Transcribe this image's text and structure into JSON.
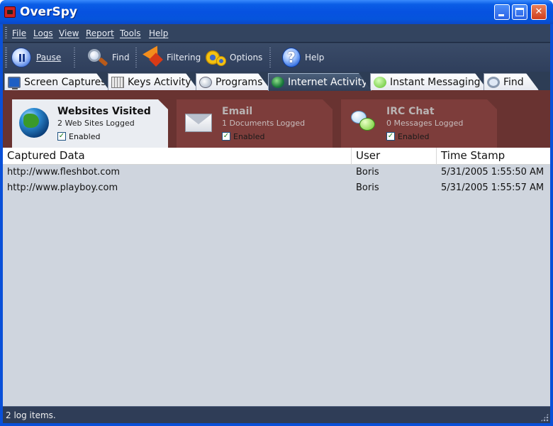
{
  "window": {
    "title": "OverSpy"
  },
  "menu": [
    "File",
    "Logs",
    "View",
    "Report",
    "Tools",
    "Help"
  ],
  "toolbar": {
    "pause": "Pause",
    "find": "Find",
    "filtering": "Filtering",
    "options": "Options",
    "help": "Help"
  },
  "tabs": [
    {
      "label": "Screen Captures",
      "icon": "monitor-icon"
    },
    {
      "label": "Keys Activity",
      "icon": "keyboard-icon"
    },
    {
      "label": "Programs",
      "icon": "programs-icon"
    },
    {
      "label": "Internet Activity",
      "icon": "globe-icon"
    },
    {
      "label": "Instant Messaging",
      "icon": "chat-icon"
    },
    {
      "label": "Find",
      "icon": "magnifier-icon"
    }
  ],
  "active_tab": "Internet Activity",
  "categories": [
    {
      "title": "Websites Visited",
      "subtitle": "2 Web Sites Logged",
      "enabled_label": "Enabled",
      "enabled": true,
      "icon": "globe-icon"
    },
    {
      "title": "Email",
      "subtitle": "1 Documents Logged",
      "enabled_label": "Enabled",
      "enabled": true,
      "icon": "envelope-icon"
    },
    {
      "title": "IRC Chat",
      "subtitle": "0 Messages Logged",
      "enabled_label": "Enabled",
      "enabled": true,
      "icon": "chat-bubbles-icon"
    }
  ],
  "list": {
    "columns": [
      "Captured Data",
      "User",
      "Time Stamp"
    ],
    "rows": [
      {
        "data": "http://www.fleshbot.com",
        "user": "Boris",
        "time": "5/31/2005 1:55:50 AM"
      },
      {
        "data": "http://www.playboy.com",
        "user": "Boris",
        "time": "5/31/2005 1:55:57 AM"
      }
    ]
  },
  "status": {
    "text": "2 log items."
  },
  "colors": {
    "titlebar": "#0a5de6",
    "panel_bg": "#693331",
    "list_bg": "#cfd5de",
    "chrome_bg": "#2d3d55"
  }
}
